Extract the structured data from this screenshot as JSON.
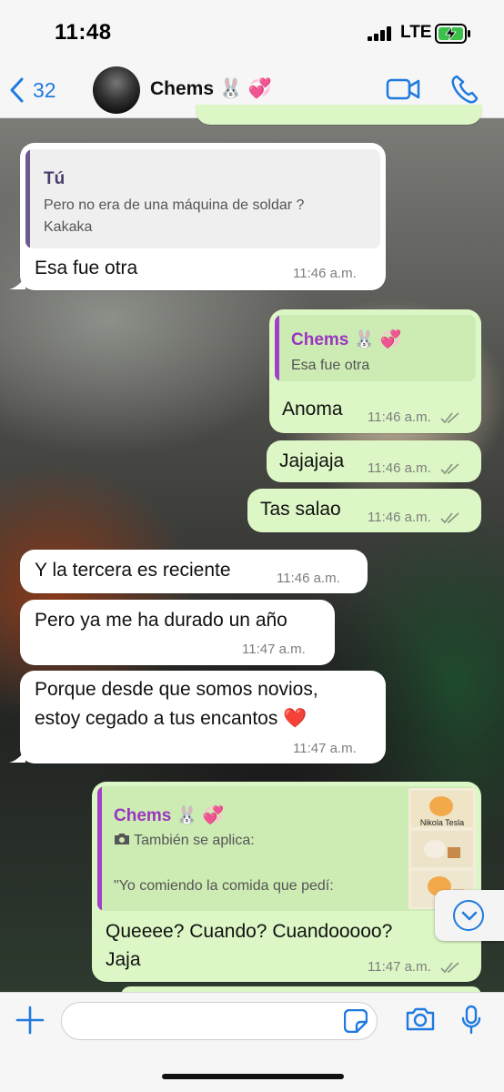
{
  "status_bar": {
    "time": "11:48",
    "network": "LTE"
  },
  "header": {
    "back_count": "32",
    "contact_name": "Chems",
    "contact_emoji": "🐰 💞"
  },
  "messages": [
    {
      "direction": "incoming",
      "quote": {
        "author": "Tú",
        "text_line1": "Pero no era de una máquina de soldar ?",
        "text_line2": "Kakaka"
      },
      "text": "Esa fue otra",
      "time": "11:46 a.m."
    },
    {
      "direction": "outgoing",
      "quote": {
        "author": "Chems 🐰 💞",
        "text": "Esa fue otra"
      },
      "text": "Anoma",
      "time": "11:46 a.m.",
      "status": "read"
    },
    {
      "direction": "outgoing",
      "text": "Jajajaja",
      "time": "11:46 a.m.",
      "status": "read"
    },
    {
      "direction": "outgoing",
      "text": "Tas salao",
      "time": "11:46 a.m.",
      "status": "read"
    },
    {
      "direction": "incoming",
      "text": "Y la tercera es reciente",
      "time": "11:46 a.m."
    },
    {
      "direction": "incoming",
      "text": "Pero ya me ha durado un año",
      "time": "11:47 a.m."
    },
    {
      "direction": "incoming",
      "text_line1": "Porque desde que somos novios,",
      "text_line2": "estoy cegado a tus encantos ❤️",
      "time": "11:47 a.m."
    },
    {
      "direction": "outgoing",
      "quote": {
        "author": "Chems 🐰 💞",
        "media_label": "También se aplica:",
        "text": "\"Yo comiendo la comida que pedí:",
        "thumbnail_caption": "Nikola Tesla"
      },
      "text_line1": "Queeee? Cuando? Cuandooooo?",
      "text_line2": "Jaja",
      "time": "11:47 a.m.",
      "status": "read"
    }
  ],
  "icons": {
    "back": "chevron-left-icon",
    "video": "video-camera-icon",
    "call": "phone-icon",
    "plus": "plus-icon",
    "sticker": "sticker-icon",
    "camera": "camera-icon",
    "mic": "microphone-icon",
    "scroll": "chevron-down-icon"
  },
  "colors": {
    "accent": "#1f7ae0",
    "incoming_bubble": "#ffffff",
    "outgoing_bubble": "#dcf7c5",
    "quote_bar_self": "#6b5b8e",
    "quote_bar_contact": "#a040c8",
    "quote_author_contact": "#9a35c0",
    "quote_author_self": "#4a3c6e"
  }
}
